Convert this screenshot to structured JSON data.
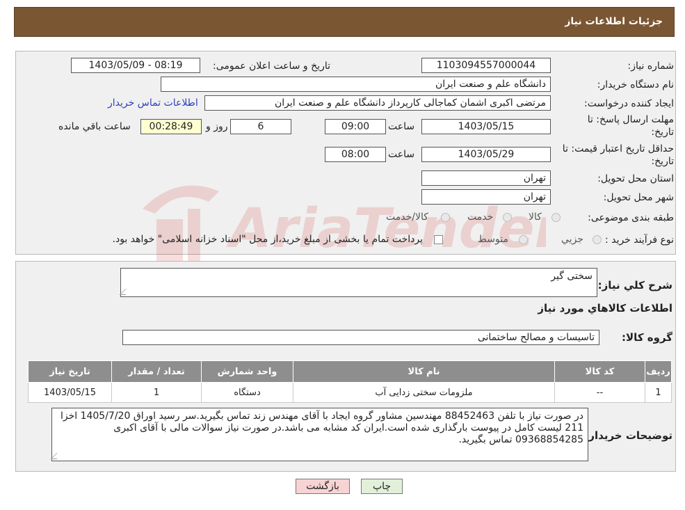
{
  "header": {
    "title": "جزئیات اطلاعات نیاز"
  },
  "fields": {
    "need_number_label": "شماره نیاز:",
    "need_number": "1103094557000044",
    "announce_label": "تاریخ و ساعت اعلان عمومی:",
    "announce_value": "1403/05/09 - 08:19",
    "buyer_org_label": "نام دستگاه خریدار:",
    "buyer_org": "دانشگاه علم و صنعت ایران",
    "creator_label": "ایجاد کننده درخواست:",
    "creator": "مرتضی اکبری اشمان کماجالی کارپرداز دانشگاه علم و صنعت ایران",
    "contact_link": "اطلاعات تماس خریدار",
    "deadline_label": "مهلت ارسال پاسخ: تا",
    "deadline_label2": "تاریخ:",
    "deadline_date": "1403/05/15",
    "time_label": "ساعت",
    "deadline_time": "09:00",
    "days_value": "6",
    "days_label": "روز و",
    "remaining_time": "00:28:49",
    "remaining_label": "ساعت باقي مانده",
    "validity_label": "حداقل تاریخ اعتبار قیمت: تا",
    "validity_label2": "تاریخ:",
    "validity_date": "1403/05/29",
    "validity_time": "08:00",
    "province_label": "استان محل تحویل:",
    "province": "تهران",
    "city_label": "شهر محل تحویل:",
    "city": "تهران",
    "category_label": "طبقه بندی موضوعی:",
    "category_options": [
      "کالا",
      "خدمت",
      "کالا/خدمت"
    ],
    "process_label": "نوع فرآیند خرید :",
    "process_options": [
      "جزيي",
      "متوسط"
    ],
    "process_note": "پرداخت تمام یا بخشی از مبلغ خرید،از محل \"اسناد خزانه اسلامی\" خواهد بود."
  },
  "details": {
    "summary_label": "شرح کلي نياز:",
    "summary": "سختی گیر",
    "items_title": "اطلاعات کالاهاي مورد نياز",
    "group_label": "گروه کالا:",
    "group": "تاسیسات و مصالح ساختمانی",
    "table": {
      "headers": [
        "رديف",
        "کد کالا",
        "نام کالا",
        "واحد شمارش",
        "تعداد / مقدار",
        "تاريخ نياز"
      ],
      "rows": [
        [
          "1",
          "--",
          "ملزومات سختی زدایی آب",
          "دستگاه",
          "1",
          "1403/05/15"
        ]
      ]
    },
    "notes_label": "توضیحات خریدار:",
    "notes": "در صورت نیاز با تلفن 88452463 مهندسین مشاور گروه ایجاد با آقای مهندس زند تماس بگیرید.سر رسید اوراق 1405/7/20 اخزا 211 لیست کامل در پیوست بارگذاری شده است.ایران کد مشابه می باشد.در صورت نیاز سوالات مالی با آقای اکبری 09368854285 تماس بگیرید."
  },
  "buttons": {
    "print": "چاپ",
    "back": "بازگشت"
  },
  "watermark": {
    "text": "AriaTender.neT"
  },
  "colors": {
    "header_bg": "#7a5632",
    "link": "#2a3fc0",
    "time_bg": "#ffffd0",
    "table_header": "#8e8e8e",
    "back_button": "#f7d4d4",
    "print_button": "#e2f0da"
  }
}
